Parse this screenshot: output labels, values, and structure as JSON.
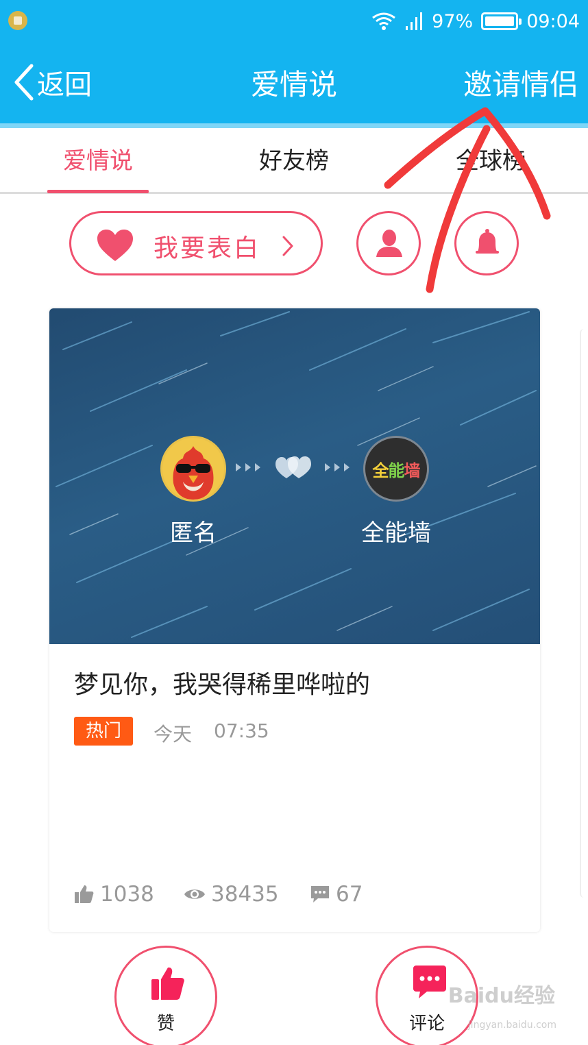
{
  "status_bar": {
    "battery_percent": "97%",
    "battery_level": 0.97,
    "time": "09:04",
    "icons": [
      "app-notification-icon",
      "wifi-icon",
      "signal-icon",
      "battery-icon"
    ]
  },
  "nav": {
    "back_label": "返回",
    "title": "爱情说",
    "invite_label": "邀请情侣"
  },
  "tabs": [
    {
      "label": "爱情说",
      "active": true
    },
    {
      "label": "好友榜",
      "active": false
    },
    {
      "label": "全球榜",
      "active": false
    }
  ],
  "actions": {
    "confess_label": "我要表白",
    "profile_icon": "person-icon",
    "notify_icon": "bell-icon"
  },
  "post": {
    "from_name": "匿名",
    "to_name": "全能墙",
    "to_logo": [
      "全",
      "能",
      "墙"
    ],
    "title": "梦见你，我哭得稀里哗啦的",
    "badge": "热门",
    "day": "今天",
    "time": "07:35",
    "likes": "1038",
    "views": "38435",
    "comments": "67"
  },
  "bottom_actions": {
    "like_label": "赞",
    "comment_label": "评论"
  },
  "watermark": {
    "brand": "Baidu经验",
    "url": "jingyan.baidu.com"
  },
  "colors": {
    "nav_blue": "#14b4f0",
    "accent_pink": "#f0506e",
    "hot_orange": "#ff5a14",
    "annotation_red": "#f03a3a"
  }
}
